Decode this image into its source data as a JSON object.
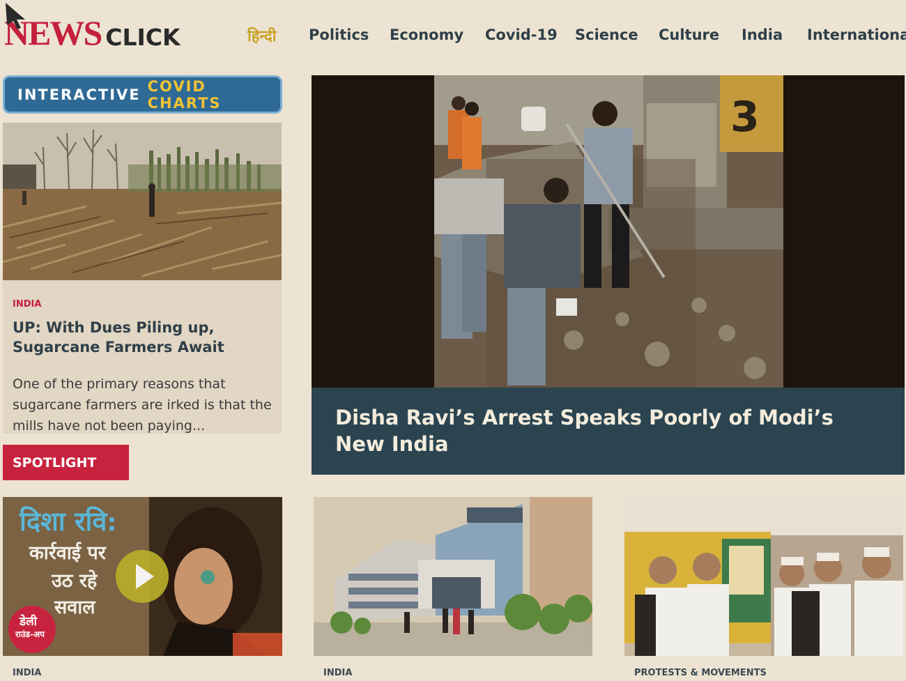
{
  "brand": {
    "logo_news": "NEWS",
    "logo_click": "CLICK",
    "accent": "#c4203c",
    "dark": "#2f3f48"
  },
  "nav": {
    "hindi": "हिन्दी",
    "items": [
      "Politics",
      "Economy",
      "Covid-19",
      "Science",
      "Culture",
      "India",
      "International"
    ]
  },
  "covid_button": {
    "part1": "INTERACTIVE",
    "part2": "COVID CHARTS",
    "bg": "#2f6a96",
    "highlight": "#f2c233"
  },
  "left_story": {
    "category": "INDIA",
    "title": "UP: With Dues Piling up, Sugarcane Farmers Await Prices for Their Crop",
    "excerpt": "One of the primary reasons that sugarcane farmers are irked is that the mills have not been paying..."
  },
  "spotlight": {
    "label": "SPOTLIGHT",
    "bg": "#c8233e"
  },
  "hero": {
    "title": "Disha Ravi’s Arrest Speaks Poorly of Modi’s New India"
  },
  "video_card": {
    "hindi_line1": "दिशा रवि:",
    "hindi_line2": "कार्रवाई पर",
    "hindi_line3": "उठ रहे",
    "hindi_line4": "सवाल",
    "badge_line1": "डेली",
    "badge_line2": "राउंड-अप",
    "play_icon": "play-icon"
  },
  "bottom_categories": [
    "INDIA",
    "INDIA",
    "PROTESTS & MOVEMENTS"
  ]
}
